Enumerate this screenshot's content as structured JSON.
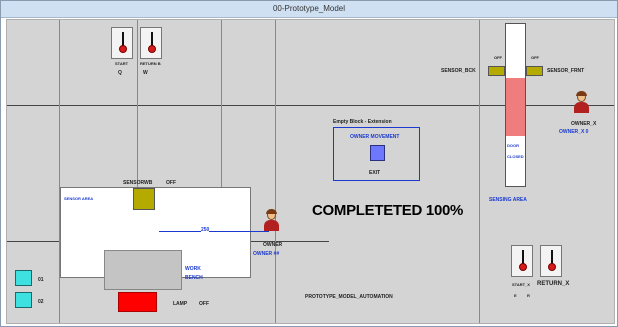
{
  "window": {
    "title": "00-Prototype_Model"
  },
  "switches": {
    "start": {
      "label": "START",
      "key": "Q"
    },
    "return_b": {
      "label": "RETURN B",
      "key": "W"
    },
    "start_x": {
      "label": "START_X",
      "key": "E"
    },
    "return_x": {
      "label": "RETURN_X",
      "key": "R"
    }
  },
  "sensors": {
    "bck": {
      "label": "SENSOR_BCK",
      "state": "OFF"
    },
    "frnt": {
      "label": "SENSOR_FRNT",
      "state": "OFF"
    },
    "rwb": {
      "label": "SENSORWB",
      "state": "OFF"
    }
  },
  "owners": {
    "x": {
      "label": "OWNER_X",
      "sublabel": "OWNER_X 0"
    },
    "main": {
      "label": "OWNER",
      "sublabel": "OWNER ##"
    }
  },
  "door": {
    "label1": "DOOR",
    "label2": "CLOSED"
  },
  "sensing_area": "SENSING AREA",
  "sensor_area": "SENSOR AREA",
  "extension": {
    "title": "Empty Block - Extension",
    "movement": "OWNER MOVEMENT",
    "exit": "EXIT"
  },
  "progress": {
    "value": "250",
    "completed_text": "COMPLETETED 100%"
  },
  "work_bench": {
    "line1": "WORK",
    "line2": "BENCH"
  },
  "lamp": {
    "label": "LAMP",
    "state": "OFF"
  },
  "outputs": [
    {
      "label": "01"
    },
    {
      "label": "02"
    }
  ],
  "footer": "PROTOTYPE_MODEL_AUTOMATION",
  "colors": {
    "sensor": "#b5ab00",
    "door": "#ef7d7d",
    "lamp": "#ff0000",
    "output": "#3ee0e0",
    "accent": "#1a3ad0"
  }
}
